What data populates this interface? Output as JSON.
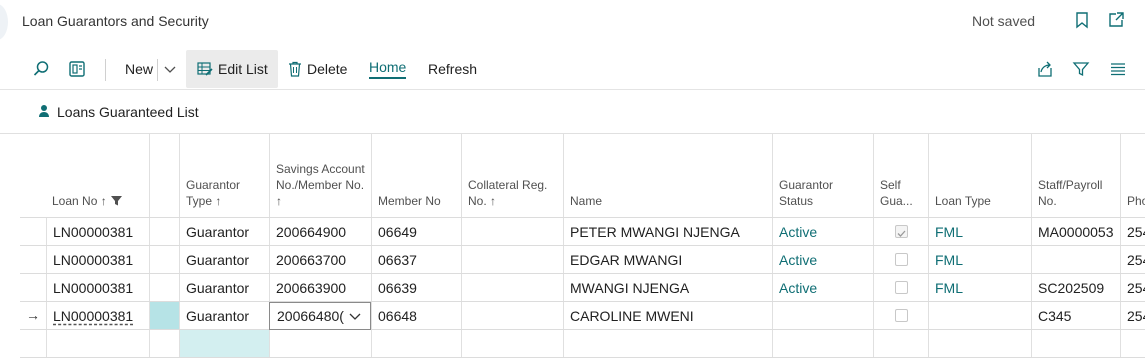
{
  "page": {
    "title": "Loan Guarantors and Security",
    "status": "Not saved"
  },
  "header_icons": [
    "bookmark-icon",
    "open-new-window-icon"
  ],
  "toolbar": {
    "new_label": "New",
    "edit_list_label": "Edit List",
    "delete_label": "Delete",
    "home_label": "Home",
    "refresh_label": "Refresh"
  },
  "subpage": {
    "title": "Loans Guaranteed List"
  },
  "columns": [
    {
      "key": "loan_no",
      "label": "Loan No ↑"
    },
    {
      "key": "blank",
      "label": ""
    },
    {
      "key": "guarantor_type",
      "label": "Guarantor Type ↑"
    },
    {
      "key": "savings_account",
      "label": "Savings Account No./Member No. ↑"
    },
    {
      "key": "member_no",
      "label": "Member No"
    },
    {
      "key": "collateral_reg",
      "label": "Collateral Reg. No. ↑"
    },
    {
      "key": "name",
      "label": "Name"
    },
    {
      "key": "guarantor_status",
      "label": "Guarantor Status"
    },
    {
      "key": "self_guarantee",
      "label": "Self Gua..."
    },
    {
      "key": "loan_type",
      "label": "Loan Type"
    },
    {
      "key": "staff_payroll",
      "label": "Staff/Payroll No."
    },
    {
      "key": "phone",
      "label": "Pho"
    }
  ],
  "rows": [
    {
      "loan_no": "LN00000381",
      "guarantor_type": "Guarantor",
      "savings_account": "200664900",
      "member_no": "06649",
      "collateral_reg": "",
      "name": "PETER MWANGI NJENGA",
      "guarantor_status": "Active",
      "self_guarantee": true,
      "loan_type": "FML",
      "staff_payroll": "MA0000053",
      "phone": "254"
    },
    {
      "loan_no": "LN00000381",
      "guarantor_type": "Guarantor",
      "savings_account": "200663700",
      "member_no": "06637",
      "collateral_reg": "",
      "name": "EDGAR MWANGI",
      "guarantor_status": "Active",
      "self_guarantee": false,
      "loan_type": "FML",
      "staff_payroll": "",
      "phone": "254"
    },
    {
      "loan_no": "LN00000381",
      "guarantor_type": "Guarantor",
      "savings_account": "200663900",
      "member_no": "06639",
      "collateral_reg": "",
      "name": "MWANGI NJENGA",
      "guarantor_status": "Active",
      "self_guarantee": false,
      "loan_type": "FML",
      "staff_payroll": "SC202509",
      "phone": "254"
    },
    {
      "loan_no": "LN00000381",
      "guarantor_type": "Guarantor",
      "savings_account": "20066480(",
      "member_no": "06648",
      "collateral_reg": "",
      "name": "CAROLINE MWENI",
      "guarantor_status": "",
      "self_guarantee": false,
      "loan_type": "",
      "staff_payroll": "C345",
      "phone": "254"
    }
  ],
  "current_row_indicator": "→",
  "colors": {
    "accent": "#0f6e74",
    "selection": "#b6e3e6"
  }
}
